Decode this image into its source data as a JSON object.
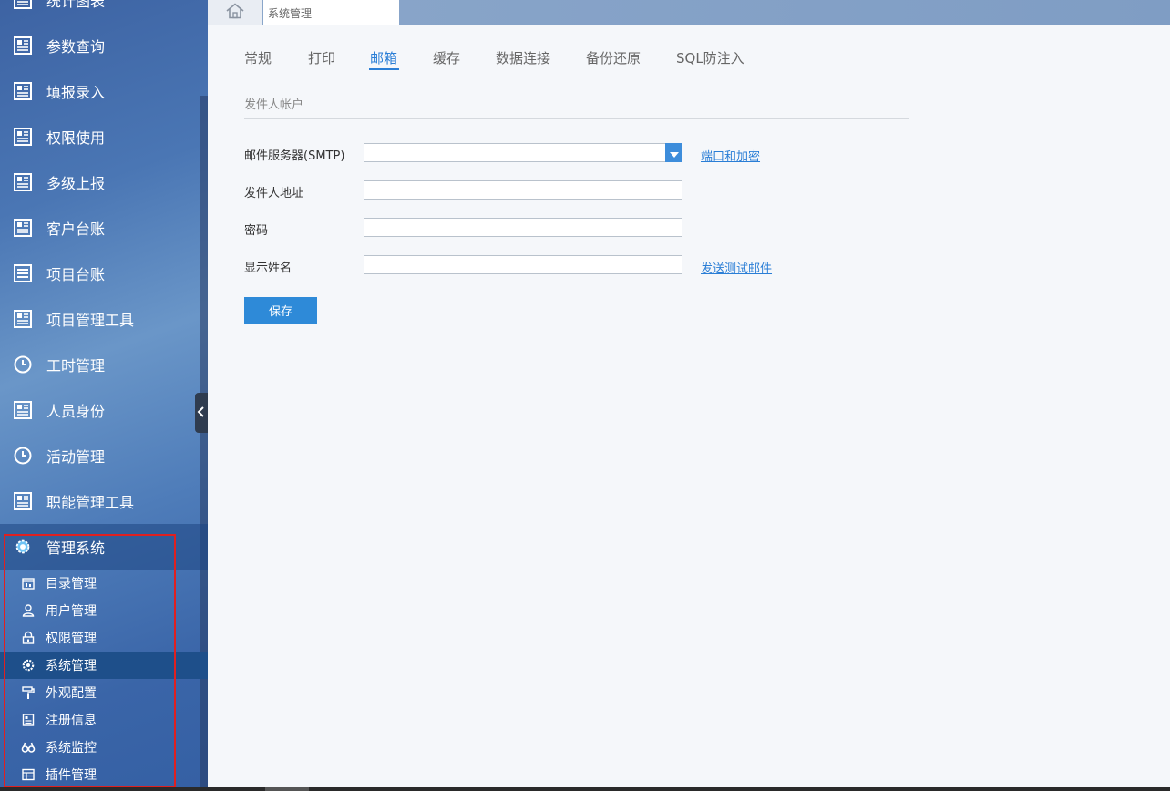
{
  "sidebar": {
    "items": [
      {
        "label": "统计图表",
        "icon": "report-icon"
      },
      {
        "label": "参数查询",
        "icon": "report-icon"
      },
      {
        "label": "填报录入",
        "icon": "report-icon"
      },
      {
        "label": "权限使用",
        "icon": "report-icon"
      },
      {
        "label": "多级上报",
        "icon": "report-icon"
      },
      {
        "label": "客户台账",
        "icon": "report-icon"
      },
      {
        "label": "项目台账",
        "icon": "list-icon"
      },
      {
        "label": "项目管理工具",
        "icon": "report-icon"
      },
      {
        "label": "工时管理",
        "icon": "clock-icon"
      },
      {
        "label": "人员身份",
        "icon": "report-icon"
      },
      {
        "label": "活动管理",
        "icon": "clock-icon"
      },
      {
        "label": "职能管理工具",
        "icon": "report-icon"
      },
      {
        "label": "管理系统",
        "icon": "gear-icon"
      }
    ],
    "subitems": [
      {
        "label": "目录管理",
        "icon": "directory-icon"
      },
      {
        "label": "用户管理",
        "icon": "user-icon"
      },
      {
        "label": "权限管理",
        "icon": "lock-icon"
      },
      {
        "label": "系统管理",
        "icon": "gear-icon"
      },
      {
        "label": "外观配置",
        "icon": "paint-roller-icon"
      },
      {
        "label": "注册信息",
        "icon": "document-icon"
      },
      {
        "label": "系统监控",
        "icon": "binoculars-icon"
      },
      {
        "label": "插件管理",
        "icon": "table-icon"
      }
    ],
    "active_subitem": "系统管理"
  },
  "topbar": {
    "tab_label": "系统管理"
  },
  "tabs": [
    "常规",
    "打印",
    "邮箱",
    "缓存",
    "数据连接",
    "备份还原",
    "SQL防注入"
  ],
  "active_tab": "邮箱",
  "section": {
    "title": "发件人帐户"
  },
  "form": {
    "smtp_label": "邮件服务器(SMTP)",
    "smtp_value": "",
    "sender_label": "发件人地址",
    "sender_value": "",
    "password_label": "密码",
    "password_value": "",
    "display_name_label": "显示姓名",
    "display_name_value": "",
    "port_link": "端口和加密",
    "test_link": "发送测试邮件",
    "save_label": "保存"
  },
  "colors": {
    "accent": "#2a7ed6",
    "button": "#2e8ad8",
    "highlight_box": "#e02020",
    "active_subitem_bg": "#1e4f8a"
  }
}
